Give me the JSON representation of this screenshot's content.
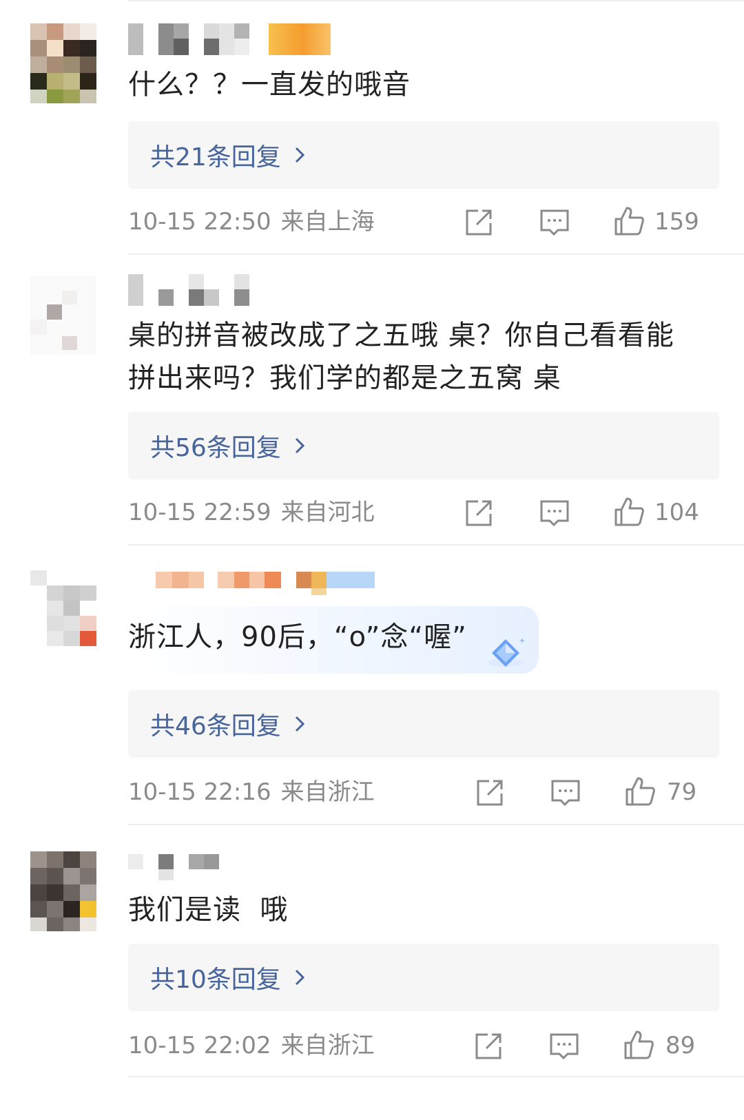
{
  "colors": {
    "link": "#48659b",
    "meta": "#8a8a8a",
    "text": "#222222",
    "reply_bg": "#f6f6f6"
  },
  "comments": [
    {
      "text": "什么？？一直发的哦音",
      "replies": "共21条回复",
      "time": "10-15 22:50",
      "location": "来自上海",
      "likes": "159"
    },
    {
      "text": "桌的拼音被改成了之五哦 桌？你自己看看能拼出来吗？我们学的都是之五窝 桌",
      "replies": "共56条回复",
      "time": "10-15 22:59",
      "location": "来自河北",
      "likes": "104"
    },
    {
      "text": "浙江人，90后，“o”念“喔”",
      "replies": "共46条回复",
      "time": "10-15 22:16",
      "location": "来自浙江",
      "likes": "79"
    },
    {
      "text": "我们是读  哦",
      "replies": "共10条回复",
      "time": "10-15 22:02",
      "location": "来自浙江",
      "likes": "89"
    }
  ],
  "icons": [
    "share-icon",
    "comment-icon",
    "like-icon",
    "chevron-right-icon",
    "gem-badge-icon"
  ]
}
